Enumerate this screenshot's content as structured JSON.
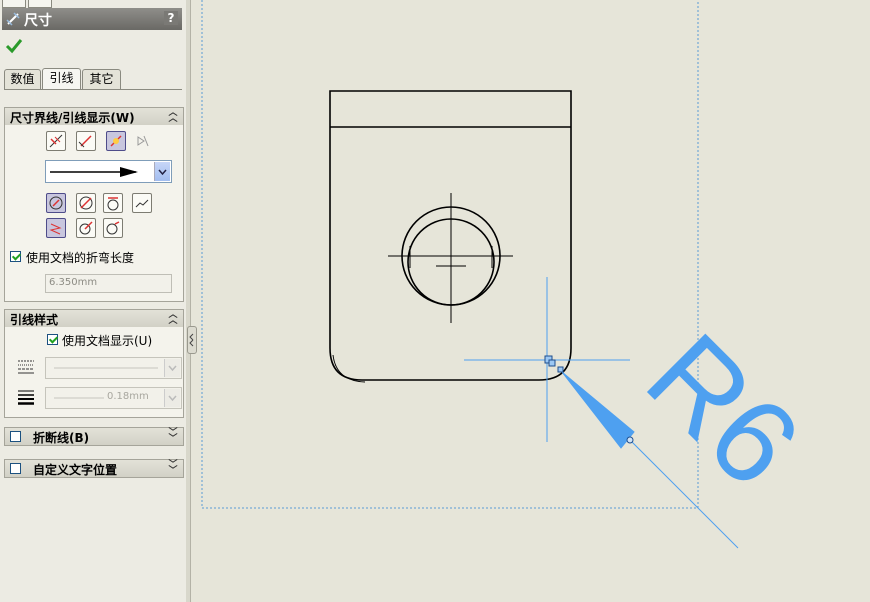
{
  "panel": {
    "title": "尺寸",
    "help": "?",
    "tabs": [
      "数值",
      "引线",
      "其它"
    ],
    "active_tab": "引线",
    "witness_group": {
      "title": "尺寸界线/引线显示(W)",
      "arrow_style": "solid-arrow",
      "use_doc_bend_label": "使用文档的折弯长度",
      "use_doc_bend_checked": true,
      "bend_length": "6.350mm"
    },
    "leader_style_group": {
      "title": "引线样式",
      "use_doc_display_label": "使用文档显示(U)",
      "use_doc_display_checked": true,
      "thickness": "0.18mm"
    },
    "break_lines": {
      "label": "折断线(B)",
      "checked": false
    },
    "custom_text_pos": {
      "label": "自定义文字位置",
      "checked": false
    }
  },
  "drawing": {
    "dimension_text": "R6",
    "selection_color": "#4ea0f0"
  }
}
